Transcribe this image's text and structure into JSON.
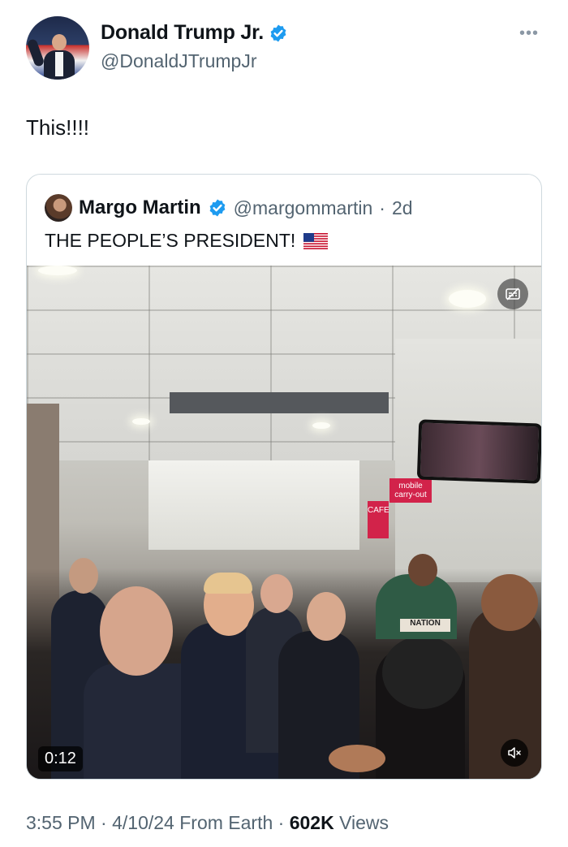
{
  "author": {
    "display_name": "Donald Trump Jr.",
    "handle": "@DonaldJTrumpJr",
    "verified": true,
    "avatar_icon": "profile-photo"
  },
  "more_icon_label": "•••",
  "tweet": {
    "text": "This!!!!"
  },
  "quoted_tweet": {
    "display_name": "Margo Martin",
    "handle": "@margommartin",
    "separator": "·",
    "age": "2d",
    "text": "THE PEOPLE’S PRESIDENT!",
    "emoji_icon": "us-flag-icon",
    "video": {
      "duration": "0:12",
      "sign_text_1": "mobile carry-out",
      "sign_text_2": "CAFE",
      "shirt_text": "NATION"
    }
  },
  "meta": {
    "time": "3:55 PM",
    "sep1": " · ",
    "date": "4/10/24 From Earth",
    "sep2": " · ",
    "views_count": "602K",
    "views_label": " Views"
  },
  "colors": {
    "verified_blue": "#1d9bf0",
    "secondary_text": "#536471",
    "border": "#cfd9de"
  }
}
